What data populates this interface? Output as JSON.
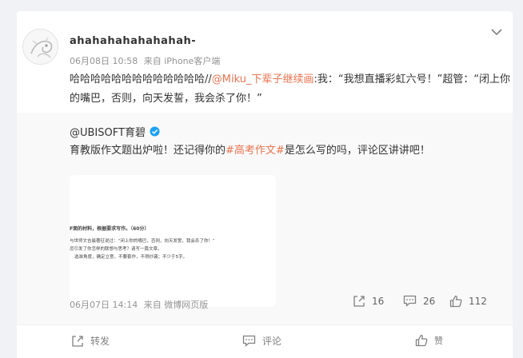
{
  "post": {
    "author": "ahahahahahahahah-",
    "date": "06月08日 10:58",
    "source": "来自 iPhone客户端",
    "text_prefix": "哈哈哈哈哈哈哈哈哈哈哈哈哈//",
    "mention": "@Miku_下辈子继续画",
    "text_suffix": ":我：“我想直播彩虹六号！”超管：“闭上你的嘴巴，否则，向天发誓，我会杀了你！”"
  },
  "retweet": {
    "author": "@UBISOFT育碧",
    "text_prefix": "育教版作文题出炉啦！还记得你的",
    "hashtag": "#高考作文#",
    "text_suffix": "是怎么写的吗，评论区讲讲吧！",
    "image_lines": [
      "F面的材料，根据要求写作。（60分）",
      "与世师文吉晨著征说过：“闭上你的嘴巴，否则，向天发誓，我会杀了你！”",
      "忌引发了你怎样的联想与思考？请写一篇文章。",
      "选准角度，确定立意，不要套作，不得抄袭；不少于5字。"
    ],
    "date": "06月07日 14:14",
    "source": "来自 微博网页版",
    "reposts": "16",
    "comments": "26",
    "likes": "112"
  },
  "actions": {
    "repost": "转发",
    "comment": "评论",
    "like": "赞"
  },
  "icons": {
    "menu": "chevron-down-icon",
    "verified": "verified-badge-icon",
    "repost": "repost-icon",
    "comment": "comment-icon",
    "like": "thumbs-up-icon"
  },
  "colors": {
    "link": "#eb7350",
    "verified": "#1da1f2",
    "meta": "#939393"
  }
}
